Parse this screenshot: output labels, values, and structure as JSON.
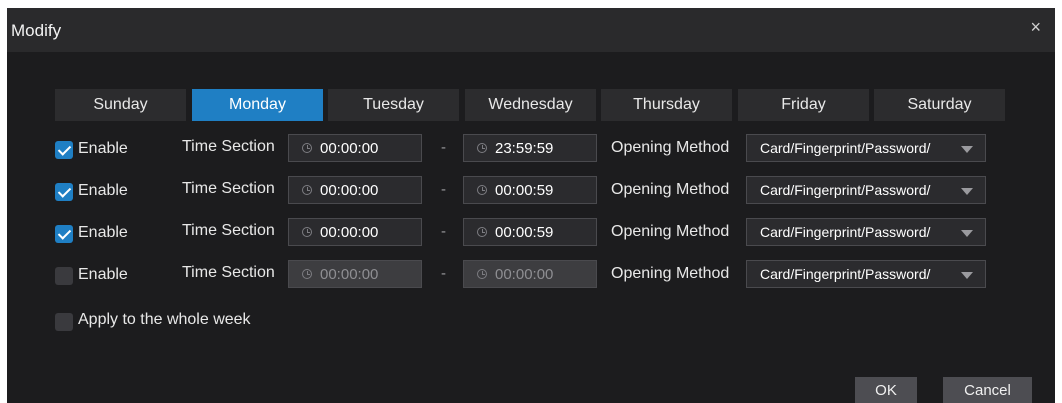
{
  "dialog": {
    "title": "Modify",
    "close_glyph": "×",
    "tabs": [
      {
        "label": "Sunday",
        "active": false
      },
      {
        "label": "Monday",
        "active": true
      },
      {
        "label": "Tuesday",
        "active": false
      },
      {
        "label": "Wednesday",
        "active": false
      },
      {
        "label": "Thursday",
        "active": false
      },
      {
        "label": "Friday",
        "active": false
      },
      {
        "label": "Saturday",
        "active": false
      }
    ],
    "rows": [
      {
        "enabled": true,
        "enable_label": "Enable",
        "time_section_label": "Time Section",
        "start": "00:00:00",
        "end": "23:59:59",
        "opening_method_label": "Opening Method",
        "method": "Card/Fingerprint/Password/"
      },
      {
        "enabled": true,
        "enable_label": "Enable",
        "time_section_label": "Time Section",
        "start": "00:00:00",
        "end": "00:00:59",
        "opening_method_label": "Opening Method",
        "method": "Card/Fingerprint/Password/"
      },
      {
        "enabled": true,
        "enable_label": "Enable",
        "time_section_label": "Time Section",
        "start": "00:00:00",
        "end": "00:00:59",
        "opening_method_label": "Opening Method",
        "method": "Card/Fingerprint/Password/"
      },
      {
        "enabled": false,
        "enable_label": "Enable",
        "time_section_label": "Time Section",
        "start": "00:00:00",
        "end": "00:00:00",
        "opening_method_label": "Opening Method",
        "method": "Card/Fingerprint/Password/"
      }
    ],
    "separator": "-",
    "apply_whole_week": {
      "label": "Apply to the whole week",
      "checked": false
    },
    "ok_label": "OK",
    "cancel_label": "Cancel"
  },
  "colors": {
    "accent": "#1f7fc4",
    "background": "#1c1c1e",
    "titlebar": "#2a2a2c"
  },
  "icons": [
    "close-icon",
    "clock-icon",
    "chevron-down-icon",
    "check-icon"
  ]
}
